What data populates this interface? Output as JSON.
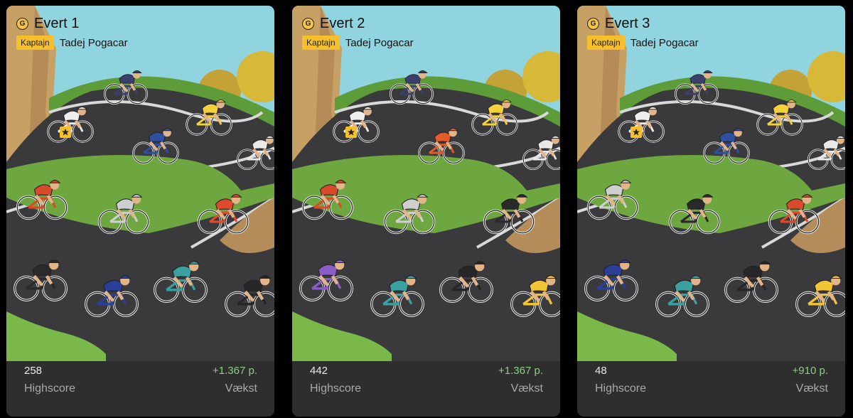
{
  "cards": [
    {
      "team_name": "Evert 1",
      "coin_letter": "G",
      "captain_badge": "Kaptajn",
      "captain_name": "Tadej Pogacar",
      "score": "258",
      "score_label": "Highscore",
      "growth": "+1.367 p.",
      "growth_label": "Vækst"
    },
    {
      "team_name": "Evert 2",
      "coin_letter": "G",
      "captain_badge": "Kaptajn",
      "captain_name": "Tadej Pogacar",
      "score": "442",
      "score_label": "Highscore",
      "growth": "+1.367 p.",
      "growth_label": "Vækst"
    },
    {
      "team_name": "Evert 3",
      "coin_letter": "G",
      "captain_badge": "Kaptajn",
      "captain_name": "Tadej Pogacar",
      "score": "48",
      "score_label": "Highscore",
      "growth": "+910 p.",
      "growth_label": "Vækst"
    }
  ],
  "colors": {
    "accent": "#f6c02d",
    "growth": "#8ccf84",
    "card_bg": "#2e2e2f",
    "sky": "#8fd4df",
    "road": "#3a3a3c",
    "grass": "#5e9c3a"
  },
  "rider_jerseys": [
    [
      "#3b3f6b",
      "#eeeeee",
      "#f2d13a",
      "#2f4fa0",
      "#e9e9e9",
      "#d94a2a",
      "#cfcfcf",
      "#e04a2c",
      "#2a2a2a",
      "#2b3f9a",
      "#3aa0a0",
      "#262626",
      "#f2c534"
    ],
    [
      "#3b3f6b",
      "#eeeeee",
      "#f2d13a",
      "#e45a2a",
      "#e9e9e9",
      "#d94a2a",
      "#cfcfcf",
      "#2a2a2a",
      "#8b5cc8",
      "#3aa0a0",
      "#262626",
      "#f2c534"
    ],
    [
      "#3b3f6b",
      "#eeeeee",
      "#f2d13a",
      "#2f4fa0",
      "#e9e9e9",
      "#cfcfcf",
      "#2a2a2a",
      "#d94a2a",
      "#2b3f9a",
      "#3aa0a0",
      "#262626",
      "#f2c534"
    ]
  ]
}
